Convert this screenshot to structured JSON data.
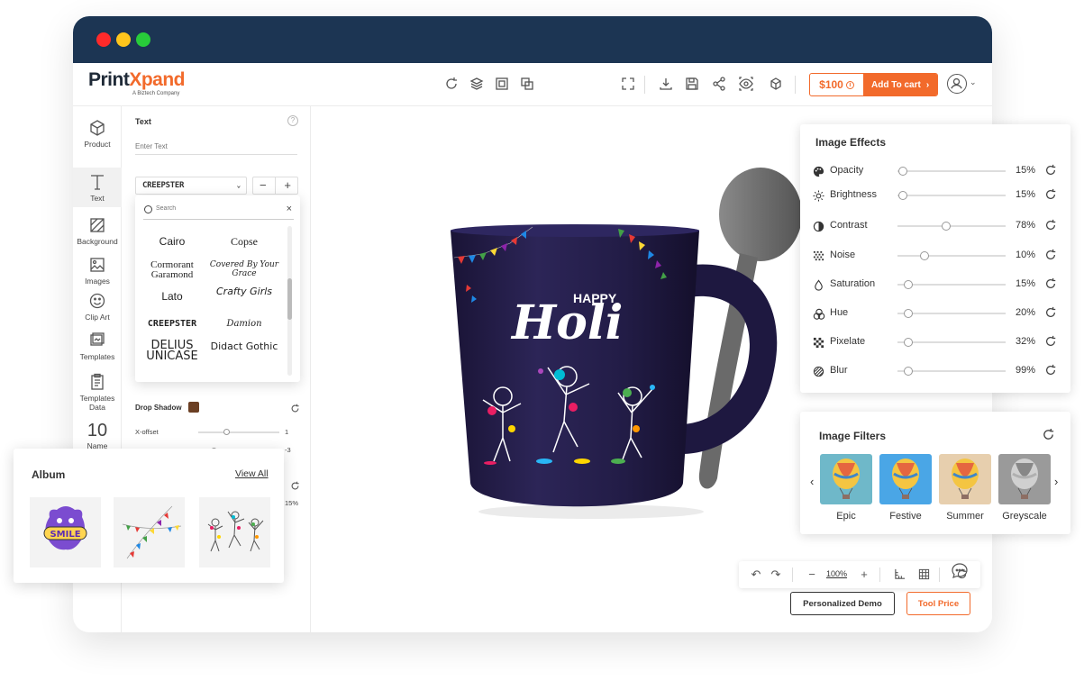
{
  "app": {
    "logo_print": "Print",
    "logo_xpand": "Xpand",
    "logo_tagline": "A Biztech Company"
  },
  "toolbar": {
    "price": "$100",
    "add_to_cart": "Add To cart"
  },
  "sidebar": {
    "items": [
      {
        "label": "Product",
        "icon": "cube-icon"
      },
      {
        "label": "Text",
        "icon": "text-icon"
      },
      {
        "label": "Background",
        "icon": "background-icon"
      },
      {
        "label": "Images",
        "icon": "image-icon"
      },
      {
        "label": "Clip Art",
        "icon": "smiley-icon"
      },
      {
        "label": "Templates",
        "icon": "templates-icon"
      },
      {
        "label": "Templates Data",
        "icon": "clipboard-icon"
      },
      {
        "label": "Name",
        "icon": "number-icon",
        "glyph": "10"
      }
    ]
  },
  "text_panel": {
    "title": "Text",
    "help": "?",
    "placeholder": "Enter Text",
    "selected_font": "CREEPSTER",
    "font_search_placeholder": "Search",
    "fonts": [
      "Cairo",
      "Copse",
      "Cormorant Garamond",
      "Covered By Your Grace",
      "Lato",
      "Crafty Girls",
      "CREEPSTER",
      "Damion",
      "DELIUS UNICASE",
      "Didact Gothic"
    ],
    "drop_shadow_label": "Drop Shadow",
    "drop_shadow_color": "#6b3f23",
    "x_offset_label": "X-offset",
    "x_offset_value": "1",
    "y_offset_value": "-3",
    "opacity_value": "15%"
  },
  "canvas": {
    "zoom": "100%",
    "mug_text_small": "HAPPY",
    "mug_text_big": "Holi",
    "personalized_demo": "Personalized Demo",
    "tool_price": "Tool Price"
  },
  "image_effects": {
    "title": "Image Effects",
    "rows": [
      {
        "label": "Opacity",
        "value": "15%",
        "level": 0.05,
        "icon": "palette-icon"
      },
      {
        "label": "Brightness",
        "value": "15%",
        "level": 0.05,
        "icon": "sun-icon"
      },
      {
        "label": "Contrast",
        "value": "78%",
        "level": 0.45,
        "icon": "contrast-icon"
      },
      {
        "label": "Noise",
        "value": "10%",
        "level": 0.25,
        "icon": "noise-icon"
      },
      {
        "label": "Saturation",
        "value": "15%",
        "level": 0.1,
        "icon": "drop-icon"
      },
      {
        "label": "Hue",
        "value": "20%",
        "level": 0.1,
        "icon": "hue-icon"
      },
      {
        "label": "Pixelate",
        "value": "32%",
        "level": 0.1,
        "icon": "pixelate-icon"
      },
      {
        "label": "Blur",
        "value": "99%",
        "level": 0.1,
        "icon": "blur-icon"
      }
    ]
  },
  "image_filters": {
    "title": "Image Filters",
    "items": [
      {
        "label": "Epic",
        "tint": "#6fb8c9"
      },
      {
        "label": "Festive",
        "tint": "#4aa6e6"
      },
      {
        "label": "Summer",
        "tint": "#e7cfae"
      },
      {
        "label": "Greyscale",
        "tint": "#9a9a9a"
      }
    ]
  },
  "album": {
    "title": "Album",
    "view_all": "View All",
    "smile_text": "SMILE"
  }
}
